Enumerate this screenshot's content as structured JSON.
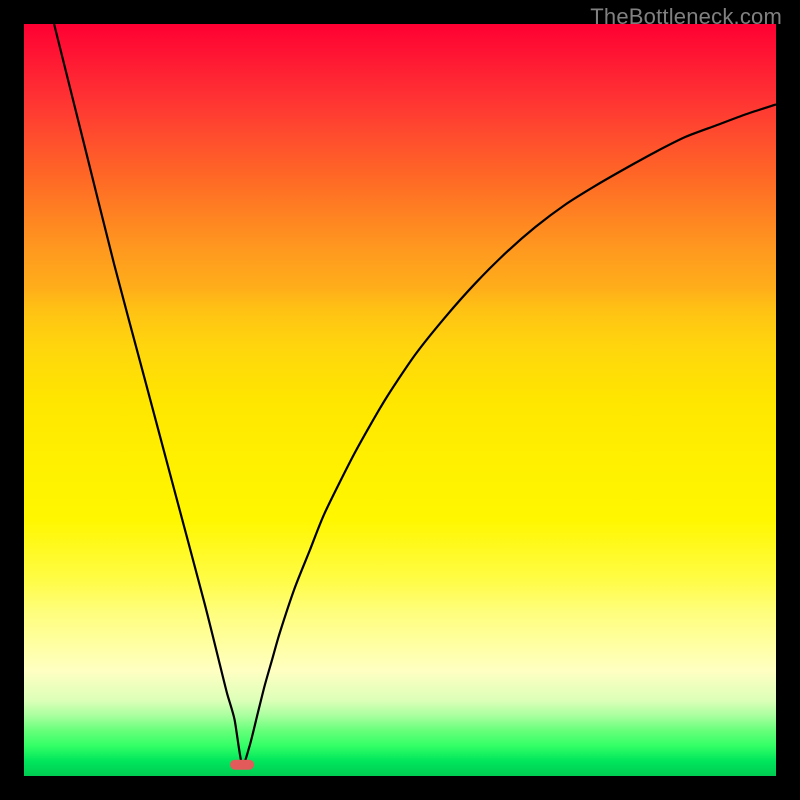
{
  "watermark": "TheBottleneck.com",
  "chart_data": {
    "type": "line",
    "title": "",
    "xlabel": "",
    "ylabel": "",
    "xlim": [
      0,
      100
    ],
    "ylim": [
      0,
      100
    ],
    "grid": false,
    "legend": false,
    "marker": {
      "x": 29,
      "y": 1.5,
      "color": "#e35a5a"
    },
    "series": [
      {
        "name": "curve",
        "x": [
          4,
          8,
          12,
          16,
          20,
          24,
          26,
          27,
          28,
          29,
          30,
          31,
          32,
          33,
          34,
          36,
          38,
          40,
          44,
          48,
          52,
          56,
          60,
          64,
          68,
          72,
          76,
          80,
          84,
          88,
          92,
          96,
          100
        ],
        "y": [
          100,
          84,
          68,
          53,
          38,
          23,
          15,
          11,
          7.5,
          1.5,
          4,
          8,
          12,
          15.5,
          19,
          25,
          30,
          35,
          43,
          50,
          56,
          61,
          65.5,
          69.5,
          73,
          76,
          78.5,
          80.8,
          83,
          85,
          86.5,
          88,
          89.3
        ]
      }
    ]
  }
}
